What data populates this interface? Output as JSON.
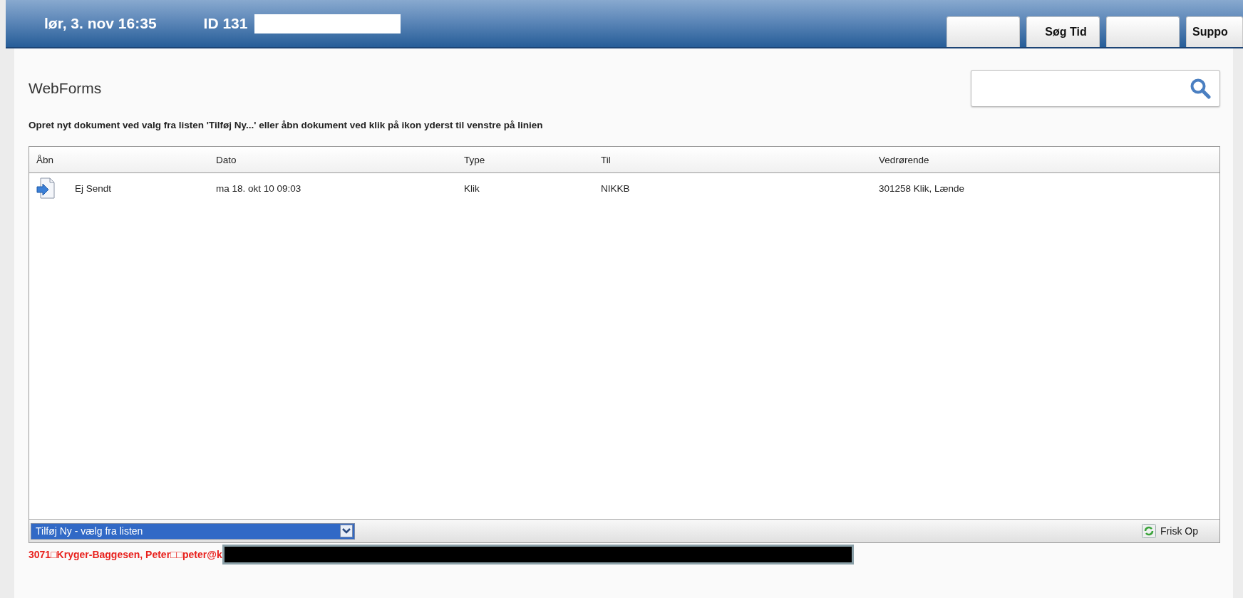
{
  "top_bar": {
    "datetime": "lør, 3. nov 16:35",
    "id_label": "ID 131",
    "buttons": [
      {
        "kind": "blank"
      },
      {
        "kind": "text",
        "label": "Søg Tid"
      },
      {
        "kind": "blank"
      },
      {
        "kind": "text",
        "label": "Suppo"
      }
    ]
  },
  "page": {
    "title": "WebForms",
    "instruction": "Opret nyt dokument ved valg fra listen 'Tilføj Ny...' eller åbn dokument ved klik på ikon yderst til venstre på linien"
  },
  "table": {
    "columns": [
      "Åbn",
      "Dato",
      "Type",
      "Til",
      "Vedrørende"
    ],
    "rows": [
      {
        "status": "Ej Sendt",
        "dato": "ma 18. okt 10 09:03",
        "type": "Klik",
        "til": "NIKKB",
        "vedrorende": "301258 Klik, Lænde"
      }
    ]
  },
  "footer": {
    "add_select": "Tilføj Ny - vælg fra listen",
    "refresh": "Frisk Op"
  },
  "user_line": "3071□Kryger-Baggesen, Peter□□peter@k"
}
